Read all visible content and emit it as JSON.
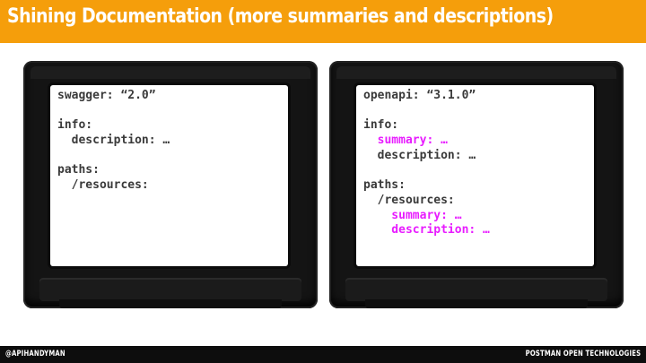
{
  "slide": {
    "title": "Shining Documentation (more summaries and descriptions)"
  },
  "left_screen": {
    "lines": [
      {
        "text": "swagger: “2.0”",
        "highlight": false
      },
      {
        "text": "",
        "highlight": false
      },
      {
        "text": "info:",
        "highlight": false
      },
      {
        "text": "  description: …",
        "highlight": false
      },
      {
        "text": "",
        "highlight": false
      },
      {
        "text": "paths:",
        "highlight": false
      },
      {
        "text": "  /resources:",
        "highlight": false
      }
    ]
  },
  "right_screen": {
    "lines": [
      {
        "text": "openapi: “3.1.0”",
        "highlight": false
      },
      {
        "text": "",
        "highlight": false
      },
      {
        "text": "info:",
        "highlight": false
      },
      {
        "text": "  summary: …",
        "highlight": true
      },
      {
        "text": "  description: …",
        "highlight": false
      },
      {
        "text": "",
        "highlight": false
      },
      {
        "text": "paths:",
        "highlight": false
      },
      {
        "text": "  /resources:",
        "highlight": false
      },
      {
        "text": "    summary: …",
        "highlight": true
      },
      {
        "text": "    description: …",
        "highlight": true
      }
    ]
  },
  "footer": {
    "left": "@APIHANDYMAN",
    "right": "POSTMAN OPEN TECHNOLOGIES"
  },
  "colors": {
    "accent": "#f59e0b",
    "highlight": "#e81cff",
    "code_text": "#3a3a3a",
    "footer_bg": "#0d0d0d"
  }
}
